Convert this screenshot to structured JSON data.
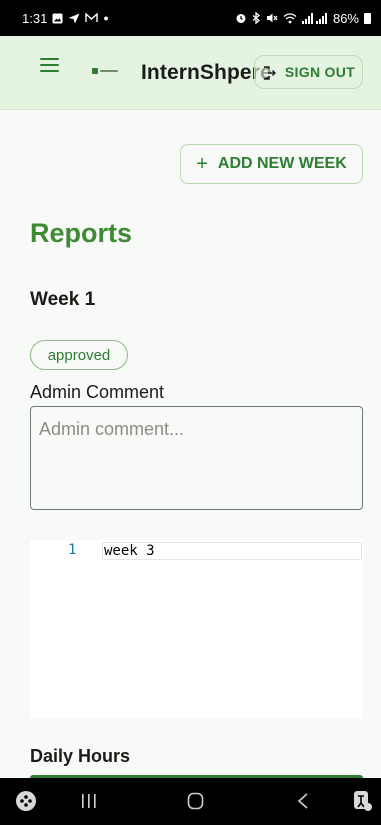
{
  "status_bar": {
    "time": "1:31",
    "battery": "86%"
  },
  "app_bar": {
    "title": "InternShpere",
    "signout_label": "SIGN OUT"
  },
  "actions": {
    "add_week_label": "ADD NEW WEEK",
    "add_symbol": "+"
  },
  "page": {
    "title": "Reports"
  },
  "week": {
    "title": "Week 1",
    "status": "approved",
    "admin_comment_label": "Admin Comment",
    "admin_comment_placeholder": "Admin comment...",
    "admin_comment_value": ""
  },
  "editor": {
    "line_number": "1",
    "line_text": "week 3"
  },
  "daily_hours": {
    "label": "Daily Hours"
  },
  "colors": {
    "primary": "#2e7d32",
    "title_green": "#3f8a35",
    "app_bar_bg": "#e5f4e1",
    "page_bg": "#f7faf6"
  },
  "icons": {
    "menu": "hamburger-icon",
    "logo": "logo-icon",
    "signout": "logout-icon",
    "nav_left": "game-launcher-icon",
    "nav_recents": "recents-icon",
    "nav_home": "home-icon",
    "nav_back": "back-icon",
    "nav_right": "accessibility-icon"
  }
}
